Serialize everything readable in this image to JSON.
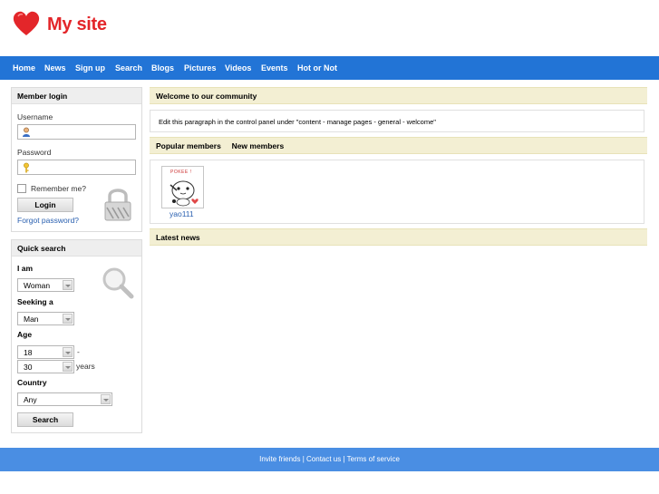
{
  "header": {
    "site_title": "My site",
    "logo_color": "#e3262a"
  },
  "nav": {
    "items": [
      "Home",
      "News",
      "Sign up",
      "Search",
      "Blogs",
      "Pictures",
      "Videos",
      "Events",
      "Hot or Not"
    ],
    "color": "#2274d6"
  },
  "member_login": {
    "title": "Member login",
    "username_label": "Username",
    "password_label": "Password",
    "remember_label": "Remember me?",
    "login_button": "Login",
    "forgot_link": "Forgot password?"
  },
  "quick_search": {
    "title": "Quick search",
    "i_am_label": "I am",
    "i_am_value": "Woman",
    "seeking_label": "Seeking a",
    "seeking_value": "Man",
    "age_label": "Age",
    "age_from": "18",
    "age_dash": "-",
    "age_to": "30",
    "age_unit": "years",
    "country_label": "Country",
    "country_value": "Any",
    "search_button": "Search"
  },
  "main": {
    "welcome_title": "Welcome to our community",
    "welcome_text": "Edit this paragraph in the control panel under \"content - manage pages - general - welcome\"",
    "tab_popular": "Popular members",
    "tab_new": "New members",
    "member_name": "yao111",
    "member_badge": "POKEE !",
    "latest_news_title": "Latest news",
    "header_bg": "#f3efd3"
  },
  "footer": {
    "invite": "Invite friends",
    "contact": "Contact us",
    "terms": "Terms of service",
    "separator": "|",
    "color": "#4a8ee3"
  }
}
